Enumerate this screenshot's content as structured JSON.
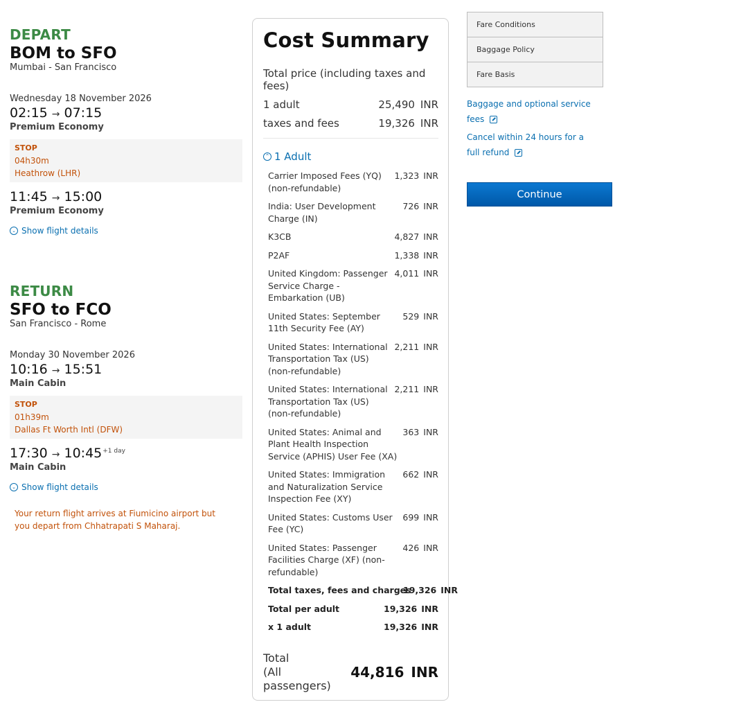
{
  "depart": {
    "heading": "DEPART",
    "route": "BOM to SFO",
    "cities": "Mumbai - San Francisco",
    "date": "Wednesday 18 November 2026",
    "seg1": {
      "dep": "02:15",
      "arr": "07:15",
      "cabin": "Premium Economy"
    },
    "stop": {
      "label": "STOP",
      "duration": "04h30m",
      "airport": "Heathrow (LHR)"
    },
    "seg2": {
      "dep": "11:45",
      "arr": "15:00",
      "cabin": "Premium Economy"
    },
    "show_details": "Show flight details"
  },
  "return": {
    "heading": "RETURN",
    "route": "SFO to FCO",
    "cities": "San Francisco - Rome",
    "date": "Monday 30 November 2026",
    "seg1": {
      "dep": "10:16",
      "arr": "15:51",
      "cabin": "Main Cabin"
    },
    "stop": {
      "label": "STOP",
      "duration": "01h39m",
      "airport": "Dallas Ft Worth Intl (DFW)"
    },
    "seg2": {
      "dep": "17:30",
      "arr": "10:45",
      "arr_plus": "+1 day",
      "cabin": "Main Cabin"
    },
    "show_details": "Show flight details",
    "warning": "Your return flight arrives at Fiumicino airport but you depart from Chhatrapati S Maharaj."
  },
  "arrow": "→",
  "summary": {
    "title": "Cost Summary",
    "total_price_label": "Total price (including taxes and fees)",
    "adult_label": "1 adult",
    "adult_amount": "25,490",
    "taxes_label": "taxes and fees",
    "taxes_amount": "19,326",
    "currency": "INR",
    "toggle_label": "1 Adult",
    "fees": [
      {
        "name": "Carrier Imposed Fees (YQ) (non-refundable)",
        "amount": "1,323"
      },
      {
        "name": "India: User Development Charge (IN)",
        "amount": "726"
      },
      {
        "name": "K3CB",
        "amount": "4,827"
      },
      {
        "name": "P2AF",
        "amount": "1,338"
      },
      {
        "name": "United Kingdom: Passenger Service Charge - Embarkation (UB)",
        "amount": "4,011"
      },
      {
        "name": "United States: September 11th Security Fee (AY)",
        "amount": "529"
      },
      {
        "name": "United States: International Transportation Tax (US) (non-refundable)",
        "amount": "2,211"
      },
      {
        "name": "United States: International Transportation Tax (US) (non-refundable)",
        "amount": "2,211"
      },
      {
        "name": "United States: Animal and Plant Health Inspection Service (APHIS) User Fee (XA)",
        "amount": "363"
      },
      {
        "name": "United States: Immigration and Naturalization Service Inspection Fee (XY)",
        "amount": "662"
      },
      {
        "name": "United States: Customs User Fee (YC)",
        "amount": "699"
      },
      {
        "name": "United States: Passenger Facilities Charge (XF) (non-refundable)",
        "amount": "426"
      }
    ],
    "total_taxes_label": "Total taxes, fees and charges",
    "total_taxes_amount": "19,326",
    "total_per_adult_label": "Total per adult",
    "total_per_adult_amount": "19,326",
    "x_adult_label": "x 1 adult",
    "x_adult_amount": "19,326",
    "grand_label_1": "Total",
    "grand_label_2": "(All passengers)",
    "grand_amount": "44,816"
  },
  "side": {
    "tabs": [
      "Fare Conditions",
      "Baggage Policy",
      "Fare Basis"
    ],
    "baggage_link": "Baggage and optional service fees",
    "cancel_link": "Cancel within 24 hours for a full refund",
    "continue": "Continue"
  }
}
